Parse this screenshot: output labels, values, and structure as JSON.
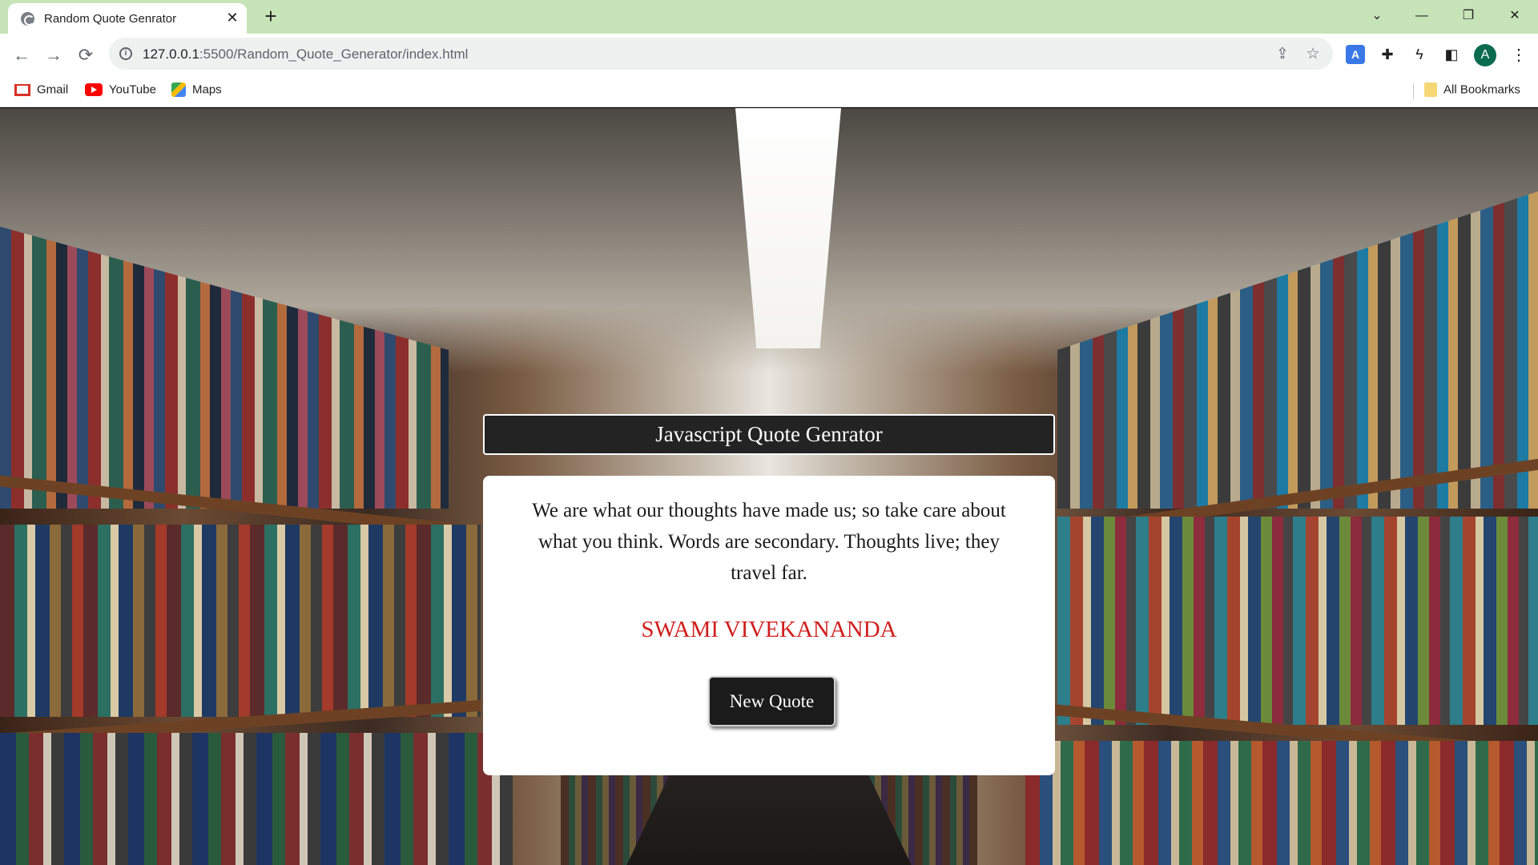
{
  "browser": {
    "tab": {
      "title": "Random Quote Genrator",
      "close_glyph": "✕"
    },
    "new_tab_glyph": "+",
    "window_controls": {
      "tab_search": "⌄",
      "minimize": "—",
      "restore": "❐",
      "close": "✕"
    },
    "nav": {
      "back": "←",
      "forward": "→",
      "reload": "⟳"
    },
    "address": {
      "host": "127.0.0.1",
      "path": ":5500/Random_Quote_Generator/index.html"
    },
    "bookmarks": [
      {
        "label": "Gmail",
        "icon": "gmail-icon"
      },
      {
        "label": "YouTube",
        "icon": "youtube-icon"
      },
      {
        "label": "Maps",
        "icon": "maps-icon"
      }
    ],
    "all_bookmarks": "All Bookmarks",
    "profile_initial": "A",
    "accent": "#c7e4b8"
  },
  "page": {
    "header": "Javascript Quote Genrator",
    "quote": "We are what our thoughts have made us; so take care about what you think. Words are secondary. Thoughts live; they travel far.",
    "author": "SWAMI VIVEKANANDA",
    "button": "New Quote",
    "author_color": "#d01e1e"
  }
}
